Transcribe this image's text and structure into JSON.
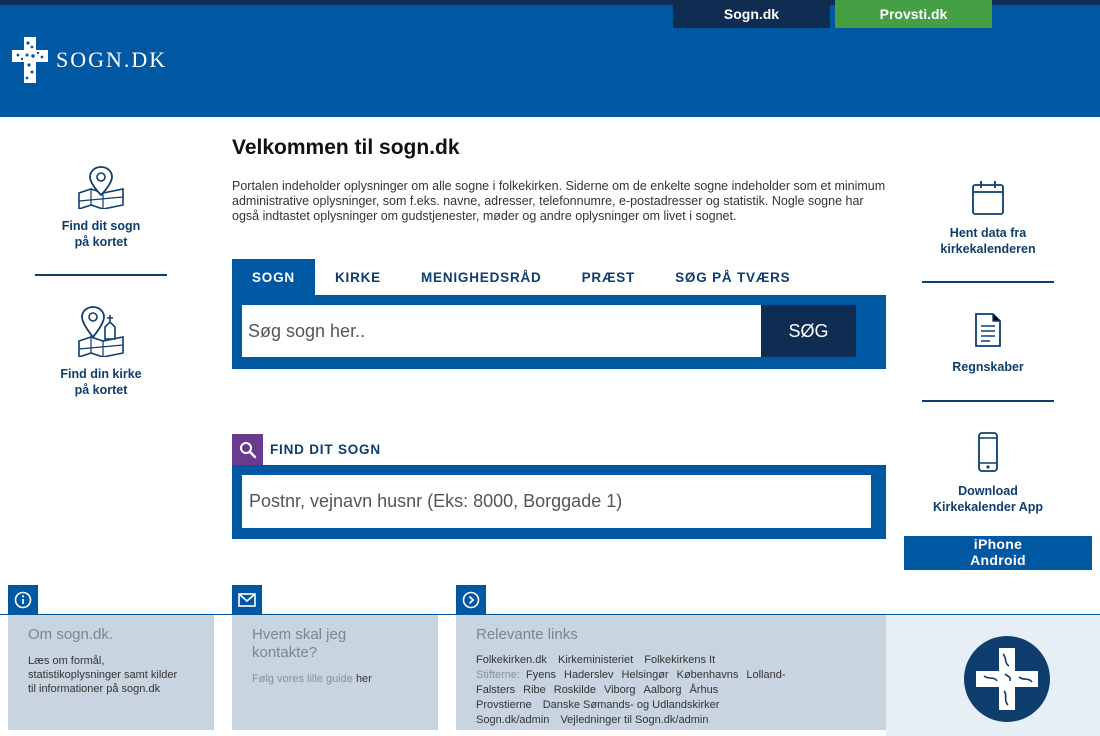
{
  "header": {
    "logo_text": "SOGN.DK",
    "tabs": [
      {
        "label": "Sogn.dk"
      },
      {
        "label": "Provsti.dk"
      }
    ],
    "colors": {
      "primary": "#0058a3",
      "dark": "#0f2d52",
      "green": "#45a045"
    }
  },
  "main": {
    "title": "Velkommen til sogn.dk",
    "intro": "Portalen indeholder oplysninger om alle sogne i folkekirken. Siderne om de enkelte sogne indeholder som et minimum administrative oplysninger, som f.eks. navne, adresser, telefonnumre, e-postadresser og statistik. Nogle sogne har også indtastet oplysninger om gudstjenester, møder og andre oplysninger om livet i sognet.",
    "search_tabs": [
      "SOGN",
      "KIRKE",
      "MENIGHEDSRÅD",
      "PRÆST",
      "SØG PÅ TVÆRS"
    ],
    "search": {
      "placeholder": "Søg sogn her..",
      "button": "SØG"
    },
    "find": {
      "label": "FIND DIT SOGN",
      "placeholder": "Postnr, vejnavn husnr (Eks: 8000, Borggade 1)"
    }
  },
  "left_sidebar": {
    "items": [
      {
        "line1": "Find dit sogn",
        "line2": "på kortet",
        "icon": "map-pin-icon"
      },
      {
        "line1": "Find din kirke",
        "line2": "på kortet",
        "icon": "map-church-icon"
      }
    ]
  },
  "right_sidebar": {
    "items": [
      {
        "line1": "Hent data fra",
        "line2": "kirkekalenderen",
        "icon": "calendar-icon"
      },
      {
        "line1": "Regnskaber",
        "line2": "",
        "icon": "document-icon"
      },
      {
        "line1": "Download",
        "line2": "Kirkekalender App",
        "icon": "phone-icon"
      }
    ],
    "apps": [
      "iPhone",
      "Android"
    ]
  },
  "footer": {
    "about": {
      "title": "Om sogn.dk.",
      "text": "Læs om formål, statistikoplysninger samt kilder til informationer på sogn.dk"
    },
    "contact": {
      "title": "Hvem skal jeg kontakte?",
      "text_prefix": "Følg vores lille guide",
      "link": "her"
    },
    "links": {
      "title": "Relevante links",
      "row1": [
        "Folkekirken.dk",
        "Kirkeministeriet",
        "Folkekirkens It"
      ],
      "stifterne_label": "Stifterne:",
      "stifter": [
        "Fyens",
        "Haderslev",
        "Helsingør",
        "Københavns",
        "Lolland-Falsters",
        "Ribe",
        "Roskilde",
        "Viborg",
        "Aalborg",
        "Århus"
      ],
      "row3": [
        "Provstierne",
        "Danske Sømands- og Udlandskirker"
      ],
      "row4": [
        "Sogn.dk/admin",
        "Vejledninger til Sogn.dk/admin"
      ]
    }
  }
}
